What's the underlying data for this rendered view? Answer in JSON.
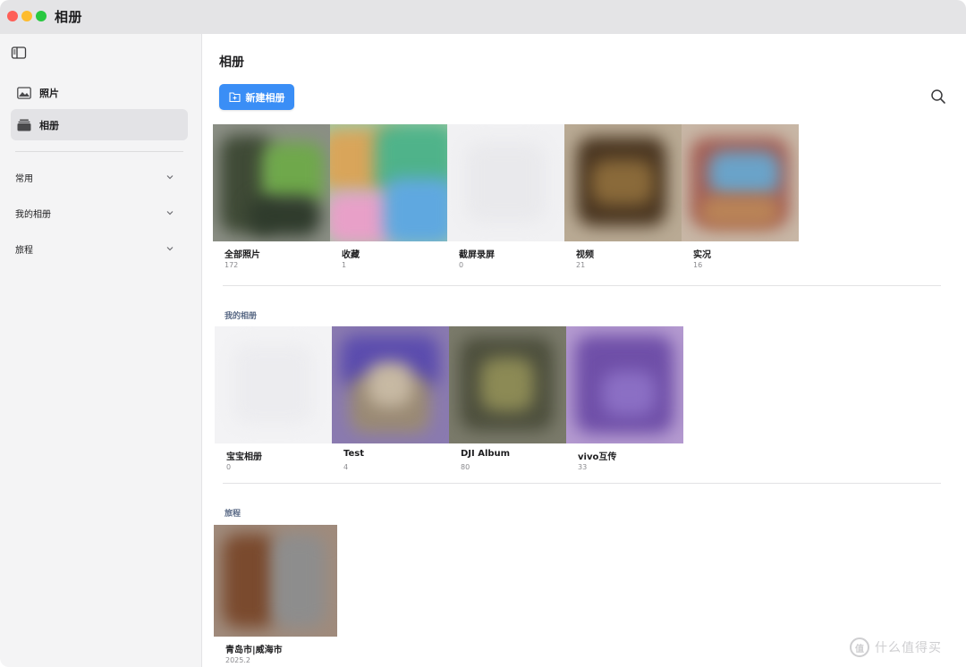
{
  "window": {
    "title": "相册",
    "traffic_lights": {
      "close": "#fe5f57",
      "minimize": "#febc2e",
      "maximize": "#28c840"
    }
  },
  "sidebar": {
    "toggle_icon": "sidebar-toggle-icon",
    "items": [
      {
        "label": "照片",
        "icon": "photo-icon",
        "active": false
      },
      {
        "label": "相册",
        "icon": "album-stack-icon",
        "active": true
      }
    ],
    "groups": [
      {
        "label": "常用",
        "icon": "chevron-down-icon"
      },
      {
        "label": "我的相册",
        "icon": "chevron-down-icon"
      },
      {
        "label": "旅程",
        "icon": "chevron-down-icon"
      }
    ]
  },
  "main": {
    "title": "相册",
    "new_album_label": "新建相册",
    "accent": "#3a8ef6",
    "search_icon": "search-icon",
    "common_albums": [
      {
        "name": "全部照片",
        "count": "172"
      },
      {
        "name": "收藏",
        "count": "1"
      },
      {
        "name": "截屏录屏",
        "count": "0"
      },
      {
        "name": "视频",
        "count": "21"
      },
      {
        "name": "实况",
        "count": "16"
      }
    ],
    "my_albums_title": "我的相册",
    "my_albums": [
      {
        "name": "宝宝相册",
        "count": "0"
      },
      {
        "name": "Test",
        "count": "4"
      },
      {
        "name": "DJI Album",
        "count": "80"
      },
      {
        "name": "vivo互传",
        "count": "33"
      }
    ],
    "journeys_title": "旅程",
    "journeys": [
      {
        "name": "青岛市|威海市",
        "date": "2025.2"
      }
    ]
  },
  "watermark": {
    "logo": "值",
    "text": "什么值得买"
  }
}
